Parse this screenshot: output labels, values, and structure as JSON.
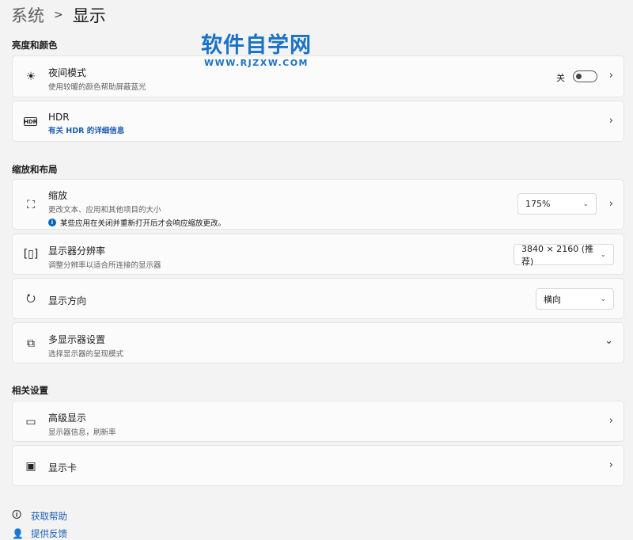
{
  "breadcrumb": {
    "parent": "系统",
    "current": "显示"
  },
  "watermark": {
    "title": "软件自学网",
    "url": "WWW.RJZXW.COM"
  },
  "sections": {
    "brightness": "亮度和颜色",
    "scale_layout": "缩放和布局",
    "related": "相关设置"
  },
  "night": {
    "title": "夜间模式",
    "desc": "使用较暖的颜色帮助屏蔽蓝光",
    "state": "关"
  },
  "hdr": {
    "title": "HDR",
    "link": "有关 HDR 的详细信息"
  },
  "scale": {
    "title": "缩放",
    "desc": "更改文本、应用和其他项目的大小",
    "note": "某些应用在关闭并重新打开后才会响应缩放更改。",
    "value": "175%"
  },
  "resolution": {
    "title": "显示器分辨率",
    "desc": "调整分辨率以适合所连接的显示器",
    "value": "3840 × 2160 (推荐)"
  },
  "orientation": {
    "title": "显示方向",
    "value": "横向"
  },
  "multi": {
    "title": "多显示器设置",
    "desc": "选择显示器的呈现模式"
  },
  "advanced": {
    "title": "高级显示",
    "desc": "显示器信息，刷新率"
  },
  "gpu": {
    "title": "显示卡"
  },
  "links": {
    "help": "获取帮助",
    "feedback": "提供反馈"
  }
}
